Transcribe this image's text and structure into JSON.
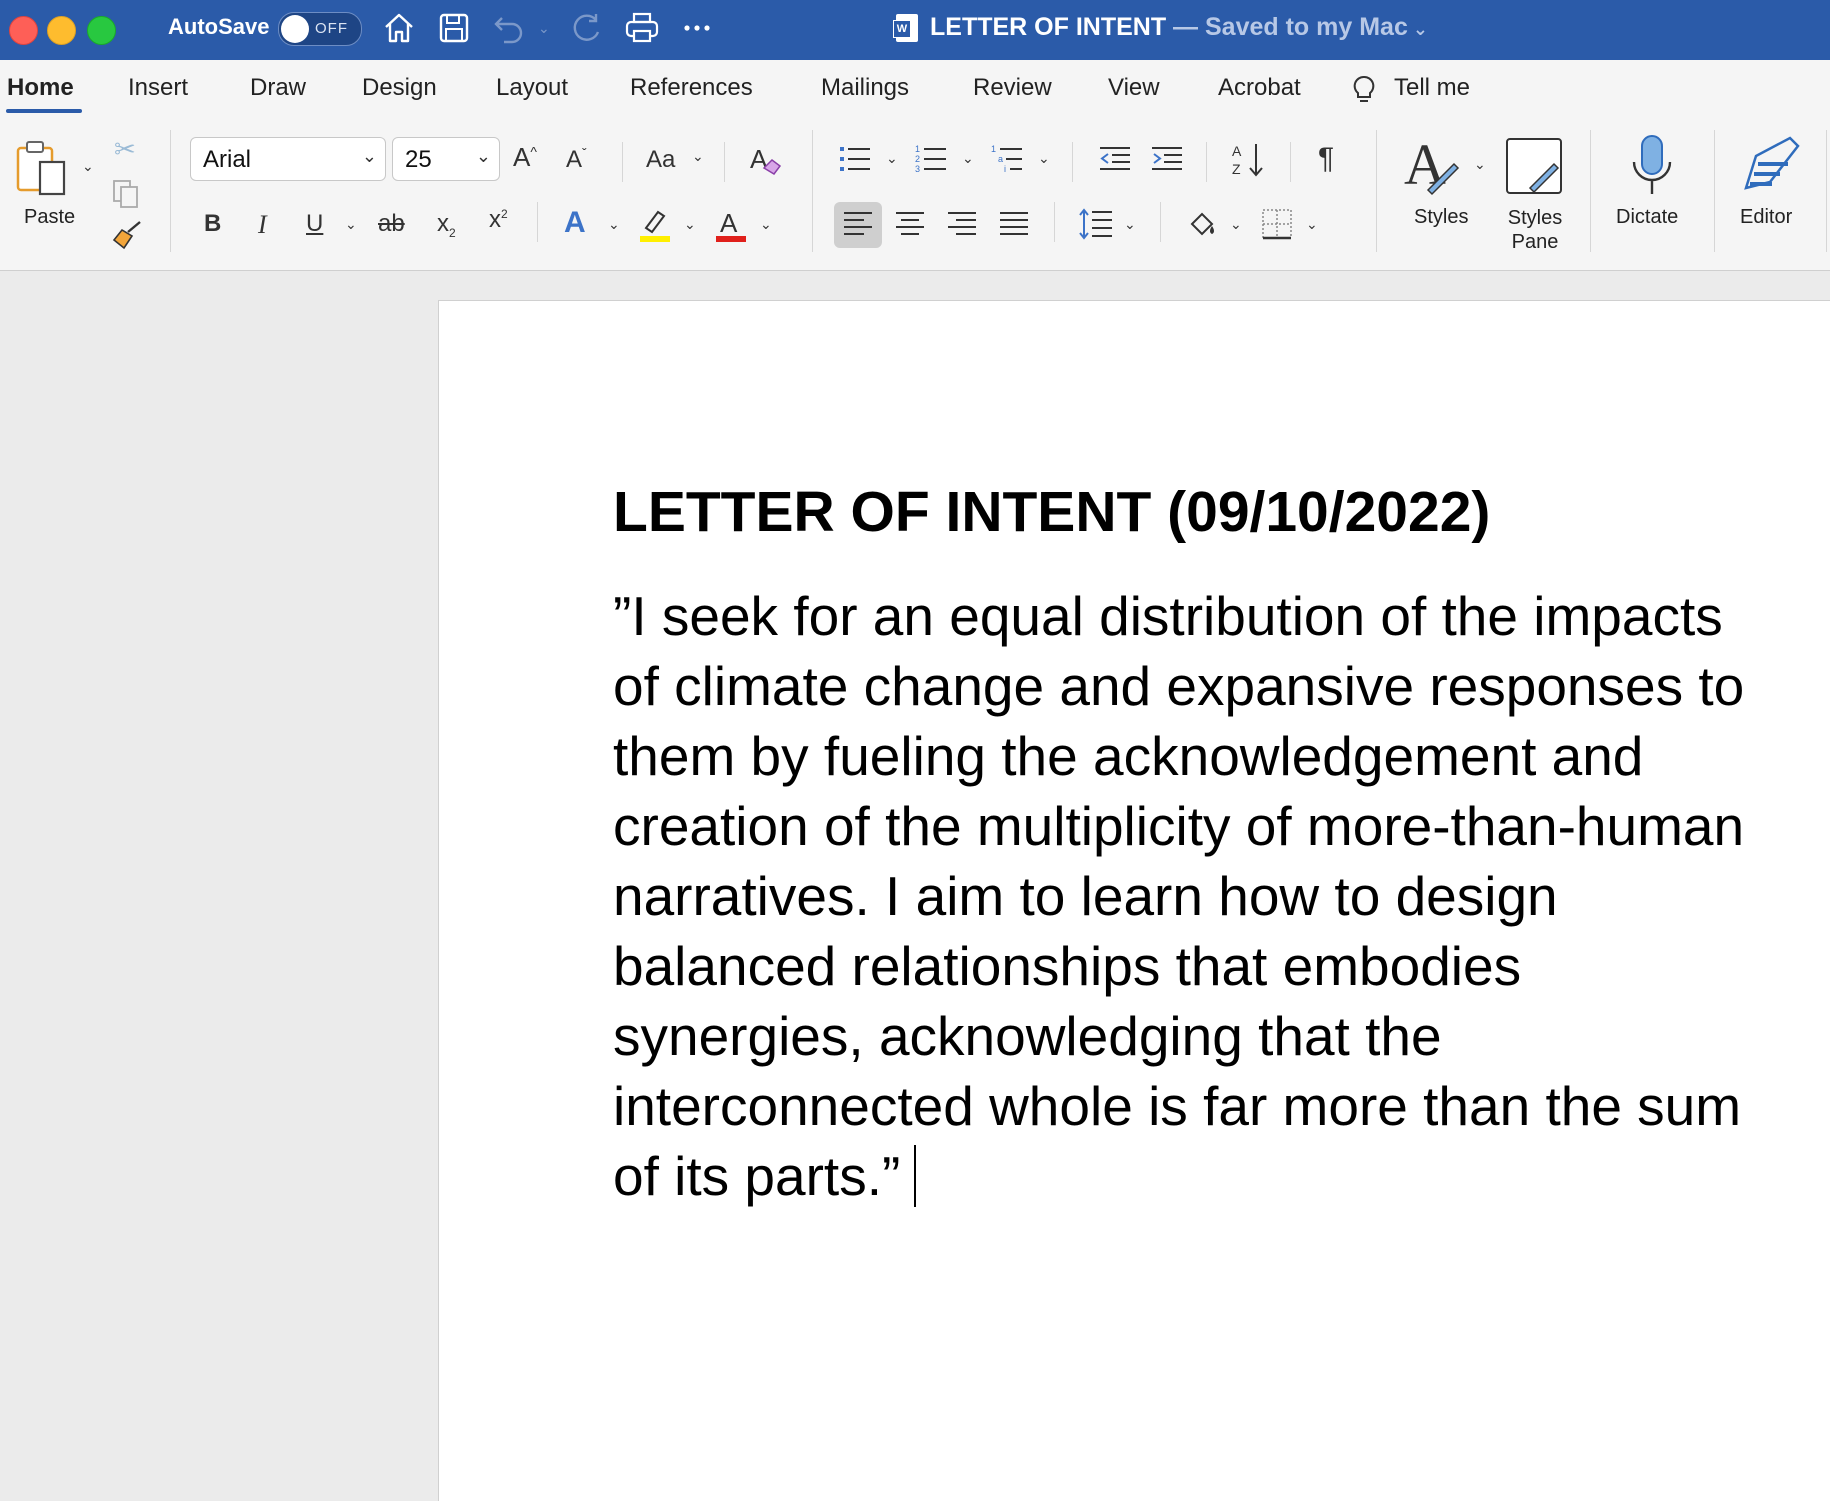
{
  "window": {
    "autosave_label": "AutoSave",
    "autosave_state": "OFF",
    "doc_title": "LETTER OF INTENT",
    "saved_status": " — Saved to my Mac"
  },
  "tabs": [
    "Home",
    "Insert",
    "Draw",
    "Design",
    "Layout",
    "References",
    "Mailings",
    "Review",
    "View",
    "Acrobat",
    "Tell me"
  ],
  "ribbon": {
    "paste_label": "Paste",
    "font_name": "Arial",
    "font_size": "25",
    "change_case_label": "Aa",
    "styles_label": "Styles",
    "styles_pane_label": "Styles Pane",
    "dictate_label": "Dictate",
    "editor_label": "Editor"
  },
  "document": {
    "heading": "LETTER OF INTENT (09/10/2022)",
    "body": "”I seek for an equal distribution of the impacts of climate change and expansive responses to them by fueling the acknowledgement and creation of the multiplicity of more-than-human narratives. I aim to learn how to design balanced relationships that embodies synergies, acknowledging that the interconnected whole is far more than the sum of its parts.”"
  },
  "colors": {
    "titlebar": "#2b5ba9",
    "highlight": "#ffef00",
    "font_color": "#e0201b"
  }
}
